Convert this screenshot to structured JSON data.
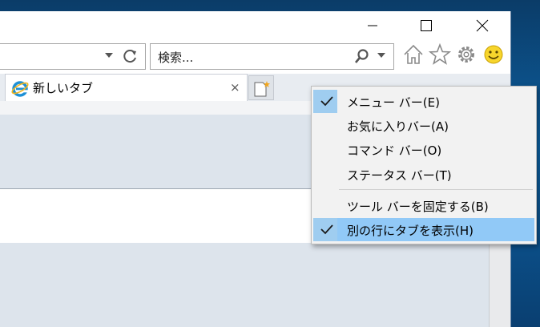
{
  "window": {
    "minimize_icon": "minimize-icon",
    "maximize_icon": "maximize-icon",
    "close_icon": "close-icon"
  },
  "addressbar": {
    "dropdown_icon": "chevron-down-icon",
    "refresh_icon": "refresh-icon"
  },
  "search": {
    "placeholder": "検索...",
    "icon": "search-icon",
    "dropdown_icon": "chevron-down-icon"
  },
  "toolbar_icons": [
    "home-icon",
    "favorites-star-icon",
    "gear-icon",
    "smiley-feedback-icon"
  ],
  "tabs": [
    {
      "title": "新しいタブ",
      "icon": "ie-logo-icon",
      "close": "×"
    }
  ],
  "new_tab_icon": "new-tab-icon",
  "context_menu": {
    "items": [
      {
        "label": "メニュー バー(E)",
        "checked": true,
        "highlighted": false
      },
      {
        "label": "お気に入りバー(A)",
        "checked": false,
        "highlighted": false
      },
      {
        "label": "コマンド バー(O)",
        "checked": false,
        "highlighted": false
      },
      {
        "label": "ステータス バー(T)",
        "checked": false,
        "highlighted": false
      },
      {
        "label": "ツール バーを固定する(B)",
        "checked": false,
        "highlighted": false
      },
      {
        "label": "別の行にタブを表示(H)",
        "checked": true,
        "highlighted": true
      }
    ]
  },
  "colors": {
    "menu_highlight": "#91c9f7",
    "check_bg": "#9fcdf0",
    "content_bg": "#dde4ec",
    "desktop": "#0c5fa0"
  }
}
